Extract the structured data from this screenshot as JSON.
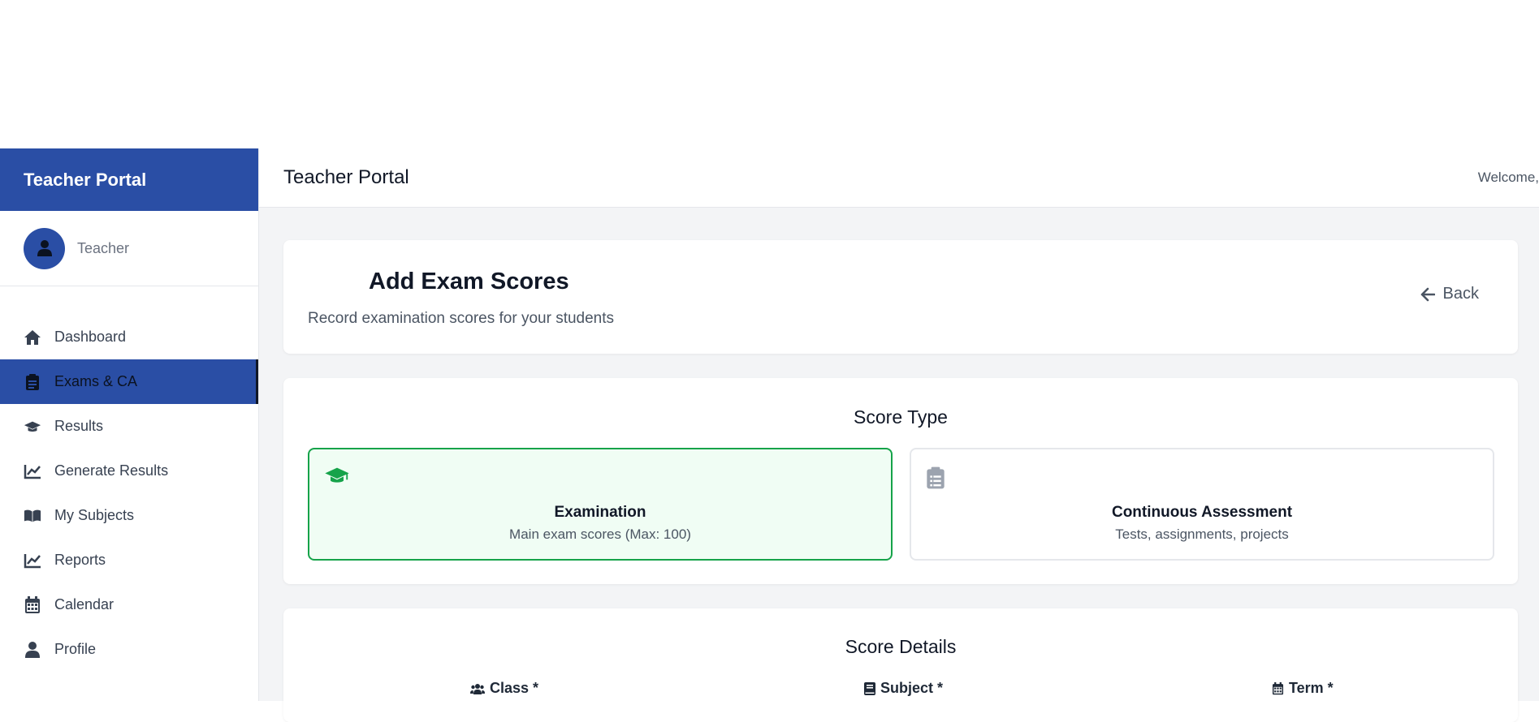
{
  "sidebar": {
    "brand": "Teacher Portal",
    "user_role": "Teacher",
    "items": [
      {
        "label": "Dashboard",
        "icon": "home-icon"
      },
      {
        "label": "Exams & CA",
        "icon": "clipboard-icon",
        "active": true
      },
      {
        "label": "Results",
        "icon": "graduation-cap-icon"
      },
      {
        "label": "Generate Results",
        "icon": "chart-line-icon"
      },
      {
        "label": "My Subjects",
        "icon": "book-open-icon"
      },
      {
        "label": "Reports",
        "icon": "chart-line-icon"
      },
      {
        "label": "Calendar",
        "icon": "calendar-icon"
      },
      {
        "label": "Profile",
        "icon": "user-icon"
      }
    ]
  },
  "header": {
    "title": "Teacher Portal",
    "welcome": "Welcome,"
  },
  "page": {
    "title": "Add Exam Scores",
    "subtitle": "Record examination scores for your students",
    "back_label": "Back"
  },
  "score_type": {
    "title": "Score Type",
    "options": [
      {
        "name": "Examination",
        "desc": "Main exam scores (Max: 100)",
        "icon": "graduation-cap-icon",
        "selected": true
      },
      {
        "name": "Continuous Assessment",
        "desc": "Tests, assignments, projects",
        "icon": "clipboard-icon",
        "selected": false
      }
    ]
  },
  "score_details": {
    "title": "Score Details",
    "fields": [
      {
        "label": "Class *",
        "icon": "users-icon"
      },
      {
        "label": "Subject *",
        "icon": "book-icon"
      },
      {
        "label": "Term *",
        "icon": "calendar-icon"
      }
    ]
  },
  "colors": {
    "primary": "#2a4ea5",
    "success": "#16a34a",
    "success_bg": "#f0fdf4"
  }
}
